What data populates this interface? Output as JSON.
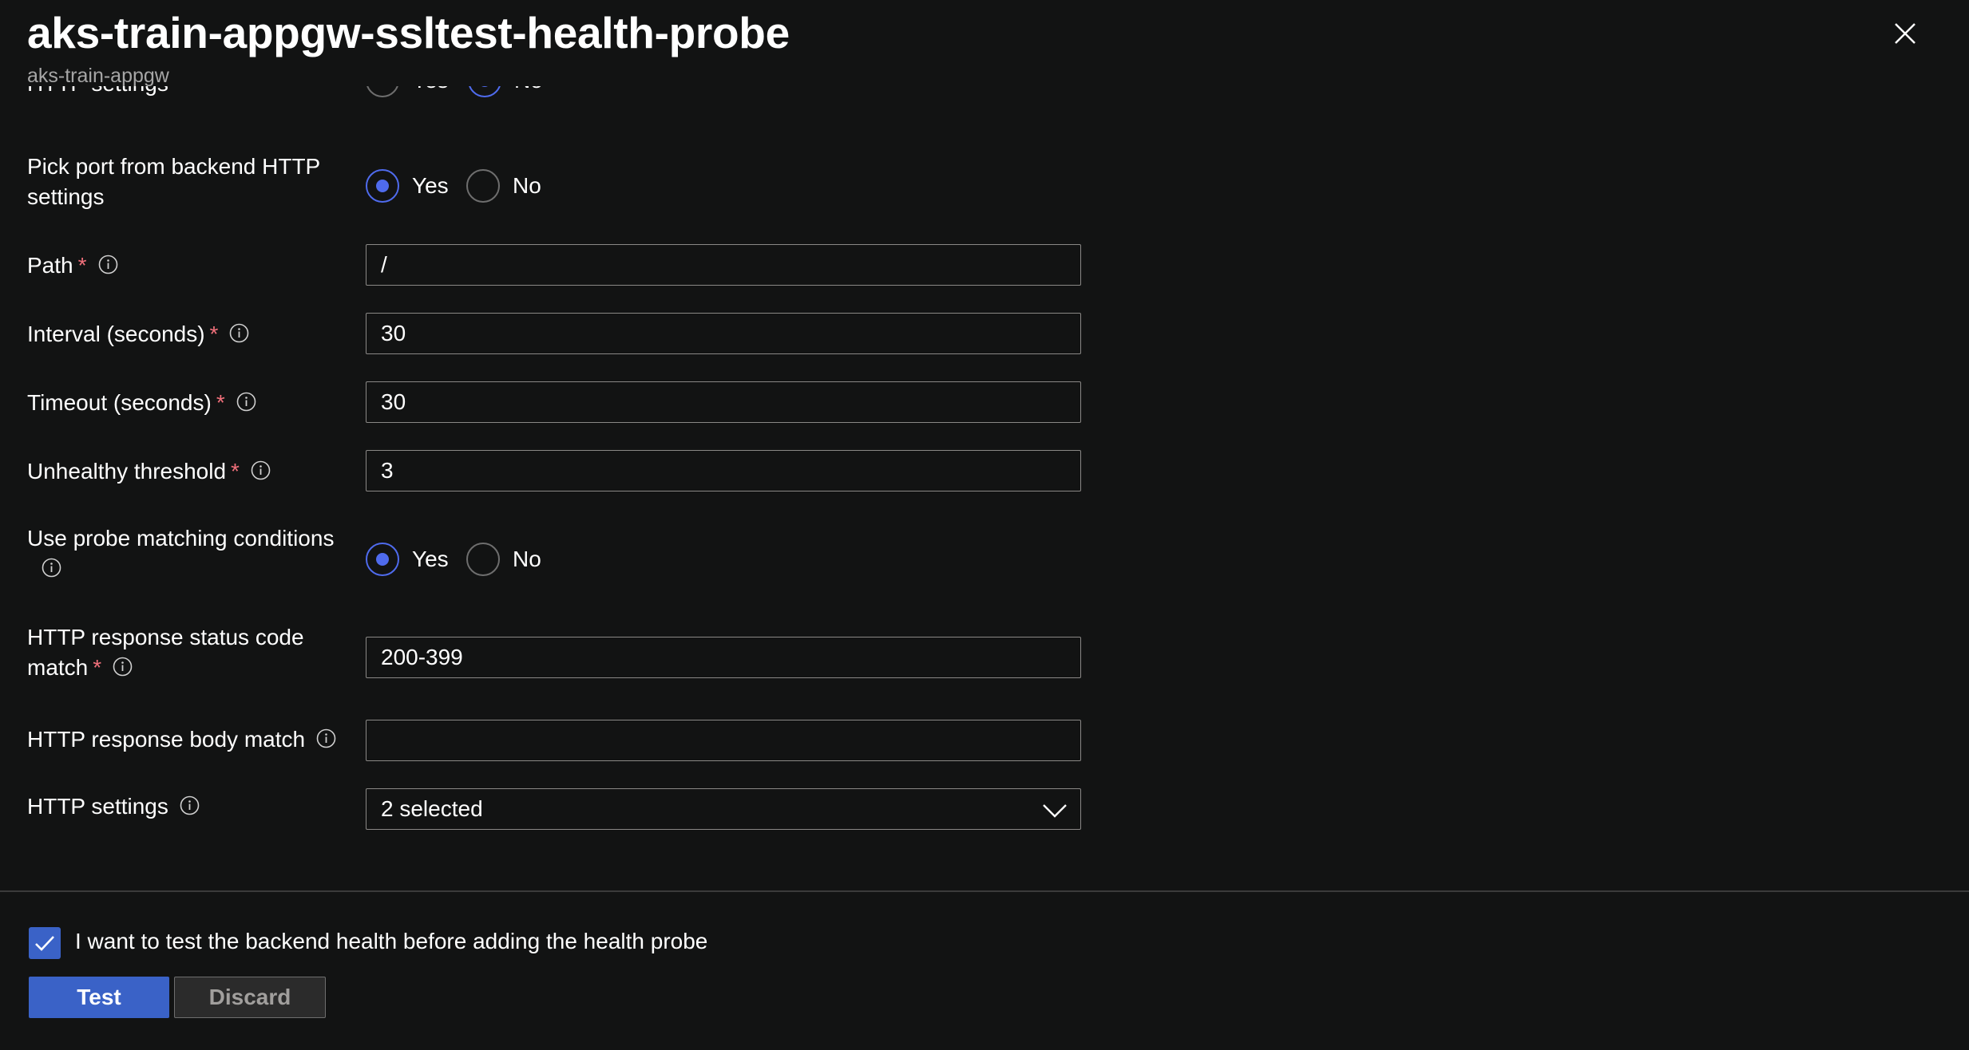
{
  "header": {
    "title": "aks-train-appgw-ssltest-health-probe",
    "subtitle": "aks-train-appgw",
    "close_icon": "close-icon"
  },
  "form": {
    "cut_off_row": {
      "label": "HTTP settings",
      "yes": "Yes",
      "no": "No"
    },
    "pick_port": {
      "label_line1": "Pick port from backend HTTP",
      "label_line2": "settings",
      "yes": "Yes",
      "no": "No",
      "selected": "Yes"
    },
    "path": {
      "label": "Path",
      "required": "*",
      "value": "/"
    },
    "interval": {
      "label": "Interval (seconds)",
      "required": "*",
      "value": "30"
    },
    "timeout": {
      "label": "Timeout (seconds)",
      "required": "*",
      "value": "30"
    },
    "unhealthy_threshold": {
      "label": "Unhealthy threshold",
      "required": "*",
      "value": "3"
    },
    "use_match": {
      "label": "Use probe matching conditions",
      "yes": "Yes",
      "no": "No",
      "selected": "Yes"
    },
    "status_code_match": {
      "label_line1": "HTTP response status code",
      "label_line2": "match",
      "required": "*",
      "value": "200-399"
    },
    "body_match": {
      "label": "HTTP response body match",
      "value": ""
    },
    "http_settings": {
      "label": "HTTP settings",
      "value": "2 selected"
    }
  },
  "footer": {
    "checkbox_label": "I want to test the backend health before adding the health probe",
    "checkbox_checked": true,
    "test_button": "Test",
    "discard_button": "Discard"
  },
  "colors": {
    "background": "#121313",
    "accent": "#3a62c7",
    "radio_accent": "#4f6bed",
    "required": "#f1707b"
  }
}
